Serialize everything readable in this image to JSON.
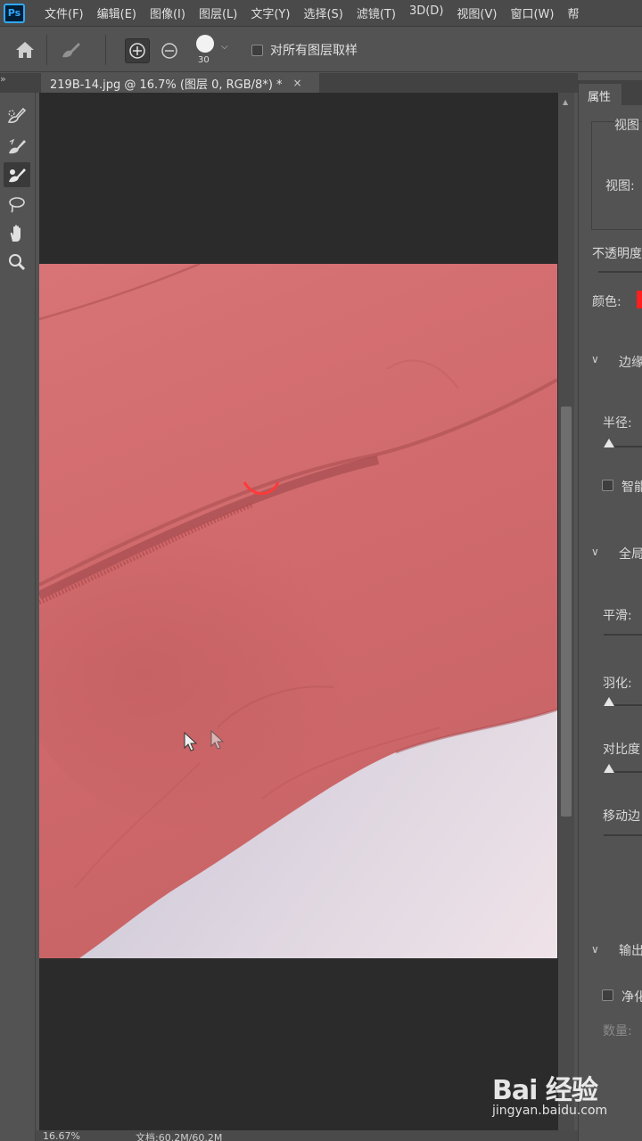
{
  "app": {
    "logo_text": "Ps"
  },
  "menu": {
    "items": [
      "文件(F)",
      "编辑(E)",
      "图像(I)",
      "图层(L)",
      "文字(Y)",
      "选择(S)",
      "滤镜(T)",
      "3D(D)",
      "视图(V)",
      "窗口(W)",
      "帮"
    ]
  },
  "options": {
    "brush_size": "30",
    "sample_all_layers_label": "对所有图层取样",
    "sample_all_layers_checked": false
  },
  "document": {
    "tab_label": "219B-14.jpg @ 16.7% (图层 0, RGB/8*) *",
    "close_glyph": "×"
  },
  "properties": {
    "tab_label": "属性",
    "view_section_label": "视图",
    "view_label": "视图:",
    "opacity_label": "不透明度",
    "color_label": "颜色:",
    "color_swatch": "#ff1f1f",
    "edge_detection_label": "边缘",
    "radius_label": "半径:",
    "smart_radius_label": "智能",
    "global_refine_label": "全局",
    "smooth_label": "平滑:",
    "feather_label": "羽化:",
    "contrast_label": "对比度",
    "shift_edge_label": "移动边",
    "output_label": "输出",
    "decontaminate_label": "净化",
    "amount_label": "数量:"
  },
  "status": {
    "zoom": "16.67%",
    "doc_size": "文档:60.2M/60.2M"
  },
  "watermark": {
    "logo": "Bai 经验",
    "url": "jingyan.baidu.com"
  }
}
